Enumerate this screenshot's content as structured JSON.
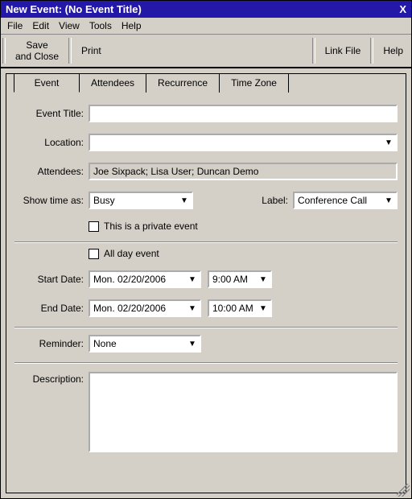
{
  "window": {
    "title": "New Event: (No Event Title)",
    "close_glyph": "X"
  },
  "menubar": [
    "File",
    "Edit",
    "View",
    "Tools",
    "Help"
  ],
  "toolbar": {
    "save_close": "Save\nand Close",
    "print": "Print",
    "link_file": "Link File",
    "help": "Help"
  },
  "tabs": [
    {
      "label": "Event",
      "active": true
    },
    {
      "label": "Attendees",
      "active": false
    },
    {
      "label": "Recurrence",
      "active": false
    },
    {
      "label": "Time Zone",
      "active": false
    }
  ],
  "labels": {
    "event_title": "Event Title:",
    "location": "Location:",
    "attendees": "Attendees:",
    "show_time_as": "Show time as:",
    "label": "Label:",
    "private_event": "This is a private event",
    "all_day": "All day event",
    "start_date": "Start Date:",
    "end_date": "End Date:",
    "reminder": "Reminder:",
    "description": "Description:"
  },
  "values": {
    "event_title": "",
    "location": "",
    "attendees": "Joe Sixpack; Lisa User; Duncan Demo",
    "show_time_as": "Busy",
    "label": "Conference Call",
    "private_checked": false,
    "all_day_checked": false,
    "start_date": "Mon. 02/20/2006",
    "start_time": "9:00 AM",
    "end_date": "Mon. 02/20/2006",
    "end_time": "10:00 AM",
    "reminder": "None",
    "description": ""
  }
}
